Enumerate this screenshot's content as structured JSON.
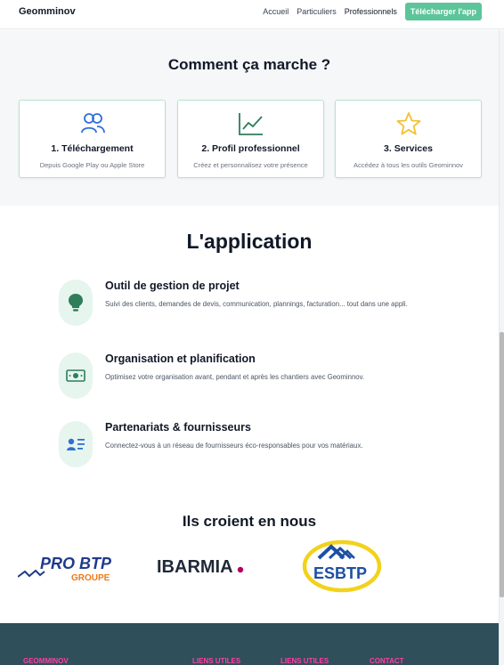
{
  "header": {
    "brand": "Geomminov",
    "nav": {
      "accueil": "Accueil",
      "particuliers": "Particuliers",
      "professionnels": "Professionnels"
    },
    "cta_label": "Télécharger l'app",
    "cta_color": "#5cc59a"
  },
  "how": {
    "title": "Comment ça marche ?",
    "steps": [
      {
        "icon": "users-icon",
        "title": "1. Téléchargement",
        "desc": "Depuis Google Play ou Apple Store"
      },
      {
        "icon": "chart-line-icon",
        "title": "2. Profil professionnel",
        "desc": "Créez et personnalisez votre présence"
      },
      {
        "icon": "star-icon",
        "title": "3. Services",
        "desc": "Accédez à tous les outils Geominnov"
      }
    ]
  },
  "app": {
    "title": "L'application",
    "features": [
      {
        "icon": "lightbulb-icon",
        "title": "Outil de gestion de projet",
        "desc": "Suivi des clients, demandes de devis, communication, plannings, facturation... tout dans une appli."
      },
      {
        "icon": "money-icon",
        "title": "Organisation et planification",
        "desc": "Optimisez votre organisation avant, pendant et après les chantiers avec Geominnov."
      },
      {
        "icon": "contact-list-icon",
        "title": "Partenariats & fournisseurs",
        "desc": "Connectez-vous à un réseau de fournisseurs éco-responsables pour vos matériaux."
      }
    ]
  },
  "partners": {
    "title": "Ils croient en nous",
    "logos": {
      "probtp_main": "PRO BTP",
      "probtp_sub": "GROUPE",
      "ibarmia": "IBARMIA",
      "esbtp": "ESBTP"
    }
  },
  "footer": {
    "col1": "GEOMMINOV",
    "col2": "LIENS UTILES",
    "col3": "LIENS UTILES",
    "col4": "CONTACT"
  },
  "colors": {
    "accent": "#5cc59a",
    "icon_blue": "#2f6fd6",
    "icon_green": "#2e7d5b",
    "icon_yellow": "#f2c230",
    "footer_bg": "#2f4f5a",
    "footer_link": "#ff3fa4"
  }
}
